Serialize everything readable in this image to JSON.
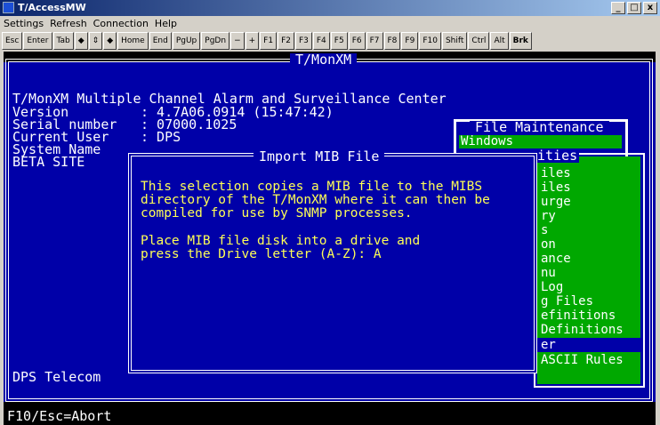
{
  "window": {
    "title": "T/AccessMW",
    "btn_min": "_",
    "btn_max": "□",
    "btn_close": "x"
  },
  "menu": [
    "Settings",
    "Refresh",
    "Connection",
    "Help"
  ],
  "toolbar": [
    "Esc",
    "Enter",
    "Tab",
    "◆",
    "⇕",
    "◆",
    "Home",
    "End",
    "PgUp",
    "PgDn",
    "−",
    "+",
    "F1",
    "F2",
    "F3",
    "F4",
    "F5",
    "F6",
    "F7",
    "F8",
    "F9",
    "F10",
    "Shift",
    "Ctrl",
    "Alt",
    "Brk"
  ],
  "screen": {
    "title": "T/MonXM",
    "heading": "T/MonXM Multiple Channel Alarm and Surveillance Center",
    "info": [
      {
        "label": "Version",
        "value": ": 4.7A06.0914 (15:47:42)"
      },
      {
        "label": "Serial number",
        "value": ": 07000.1025"
      },
      {
        "label": "Current User",
        "value": ": DPS"
      },
      {
        "label": "System Name",
        "value": ""
      }
    ],
    "site": "BETA SITE",
    "company": "DPS Telecom",
    "status": "F10/Esc=Abort"
  },
  "file_menu": {
    "title": "File Maintenance",
    "selected": "Windows"
  },
  "utilities_menu": {
    "title": "ities",
    "items": [
      "iles",
      "iles",
      "urge",
      "ry",
      "s",
      "on",
      "ance",
      "nu",
      "Log",
      "g Files",
      "efinitions",
      "Definitions",
      "er",
      "ASCII Rules"
    ]
  },
  "dialog": {
    "title": "Import MIB File",
    "lines": [
      "This selection copies a MIB file to the MIBS",
      "directory of the T/MonXM where it can then be",
      "compiled for use by SNMP processes.",
      "",
      "Place MIB file disk into a drive and",
      "press the Drive letter (A-Z): A"
    ]
  }
}
